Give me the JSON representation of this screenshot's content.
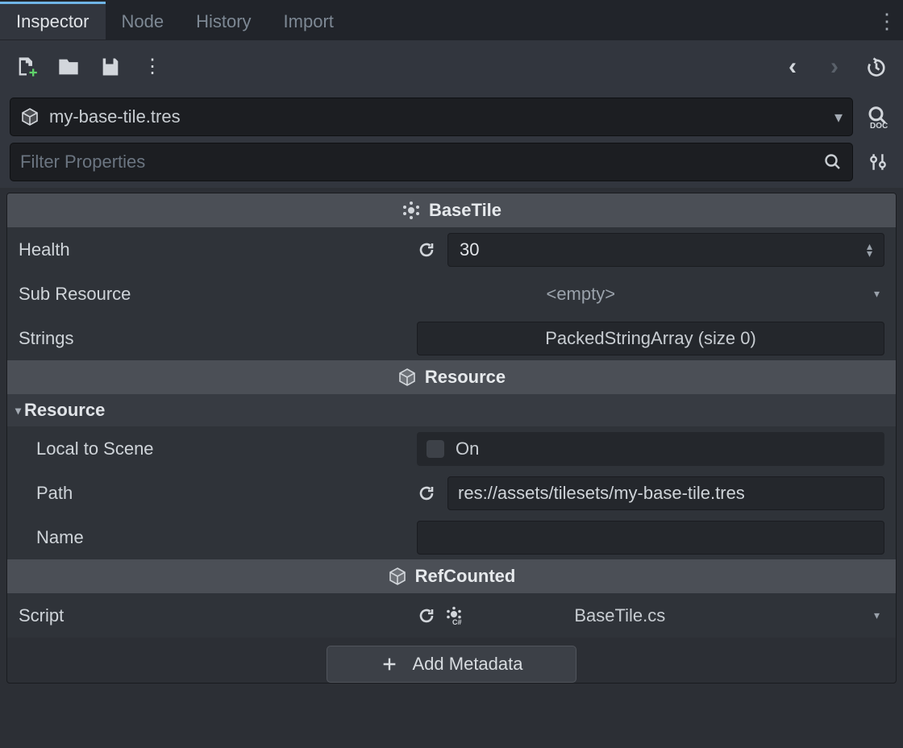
{
  "tabs": {
    "inspector": "Inspector",
    "node": "Node",
    "history": "History",
    "import": "Import"
  },
  "resource": {
    "name": "my-base-tile.tres"
  },
  "filter": {
    "placeholder": "Filter Properties"
  },
  "sections": {
    "basetile": {
      "title": "BaseTile"
    },
    "resource": {
      "title": "Resource"
    },
    "refcounted": {
      "title": "RefCounted"
    },
    "resgroup": {
      "title": "Resource"
    }
  },
  "props": {
    "health": {
      "label": "Health",
      "value": "30"
    },
    "subres": {
      "label": "Sub Resource",
      "value": "<empty>"
    },
    "strings": {
      "label": "Strings",
      "value": "PackedStringArray (size 0)"
    },
    "localscene": {
      "label": "Local to Scene",
      "value": "On"
    },
    "path": {
      "label": "Path",
      "value": "res://assets/tilesets/my-base-tile.tres"
    },
    "name": {
      "label": "Name",
      "value": ""
    },
    "script": {
      "label": "Script",
      "value": "BaseTile.cs"
    }
  },
  "buttons": {
    "addmeta": "Add Metadata"
  }
}
